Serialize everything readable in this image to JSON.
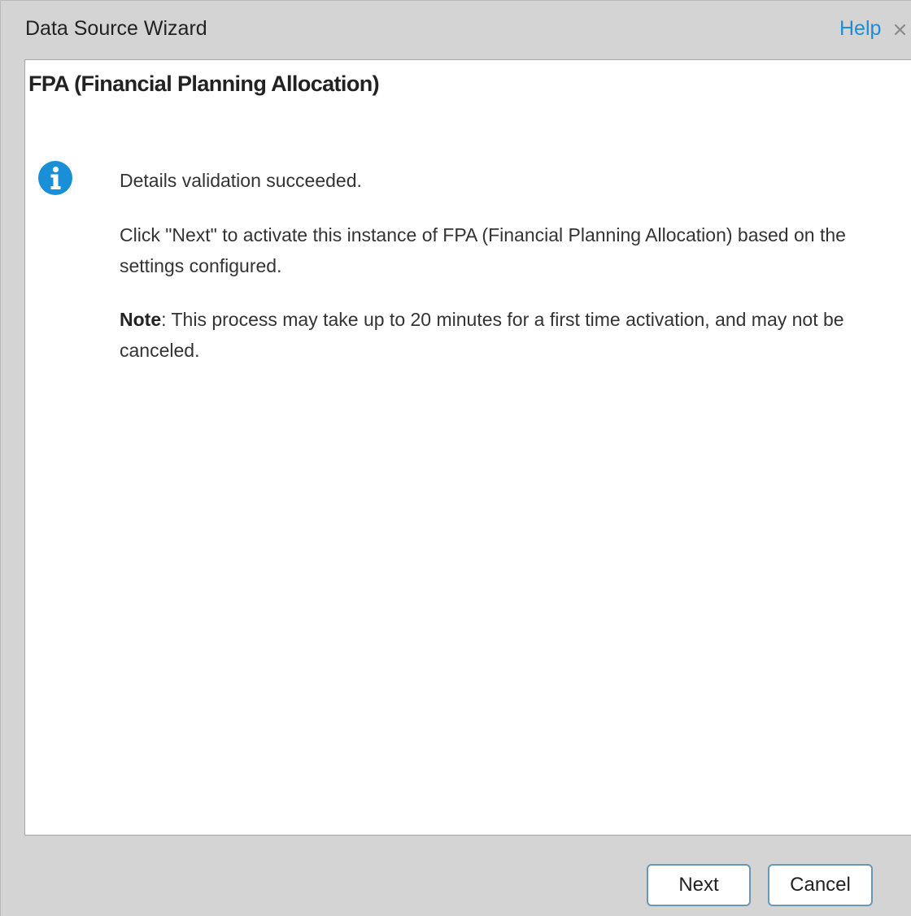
{
  "dialog": {
    "title": "Data Source Wizard",
    "help_label": "Help",
    "close_icon": "close-icon"
  },
  "content": {
    "heading": "FPA (Financial Planning Allocation)",
    "icon": "info-icon",
    "icon_color": "#1a8fd8",
    "message_success": "Details validation succeeded.",
    "message_instruction": "Click \"Next\" to activate this instance of FPA (Financial Planning Allocation) based on the settings configured.",
    "note_label": "Note",
    "note_text": ": This process may take up to 20 minutes for a first time activation, and may not be canceled."
  },
  "footer": {
    "next_label": "Next",
    "cancel_label": "Cancel"
  },
  "colors": {
    "accent": "#1a8fd8",
    "button_border": "#6a97b6",
    "chrome_background": "#d4d4d4"
  }
}
